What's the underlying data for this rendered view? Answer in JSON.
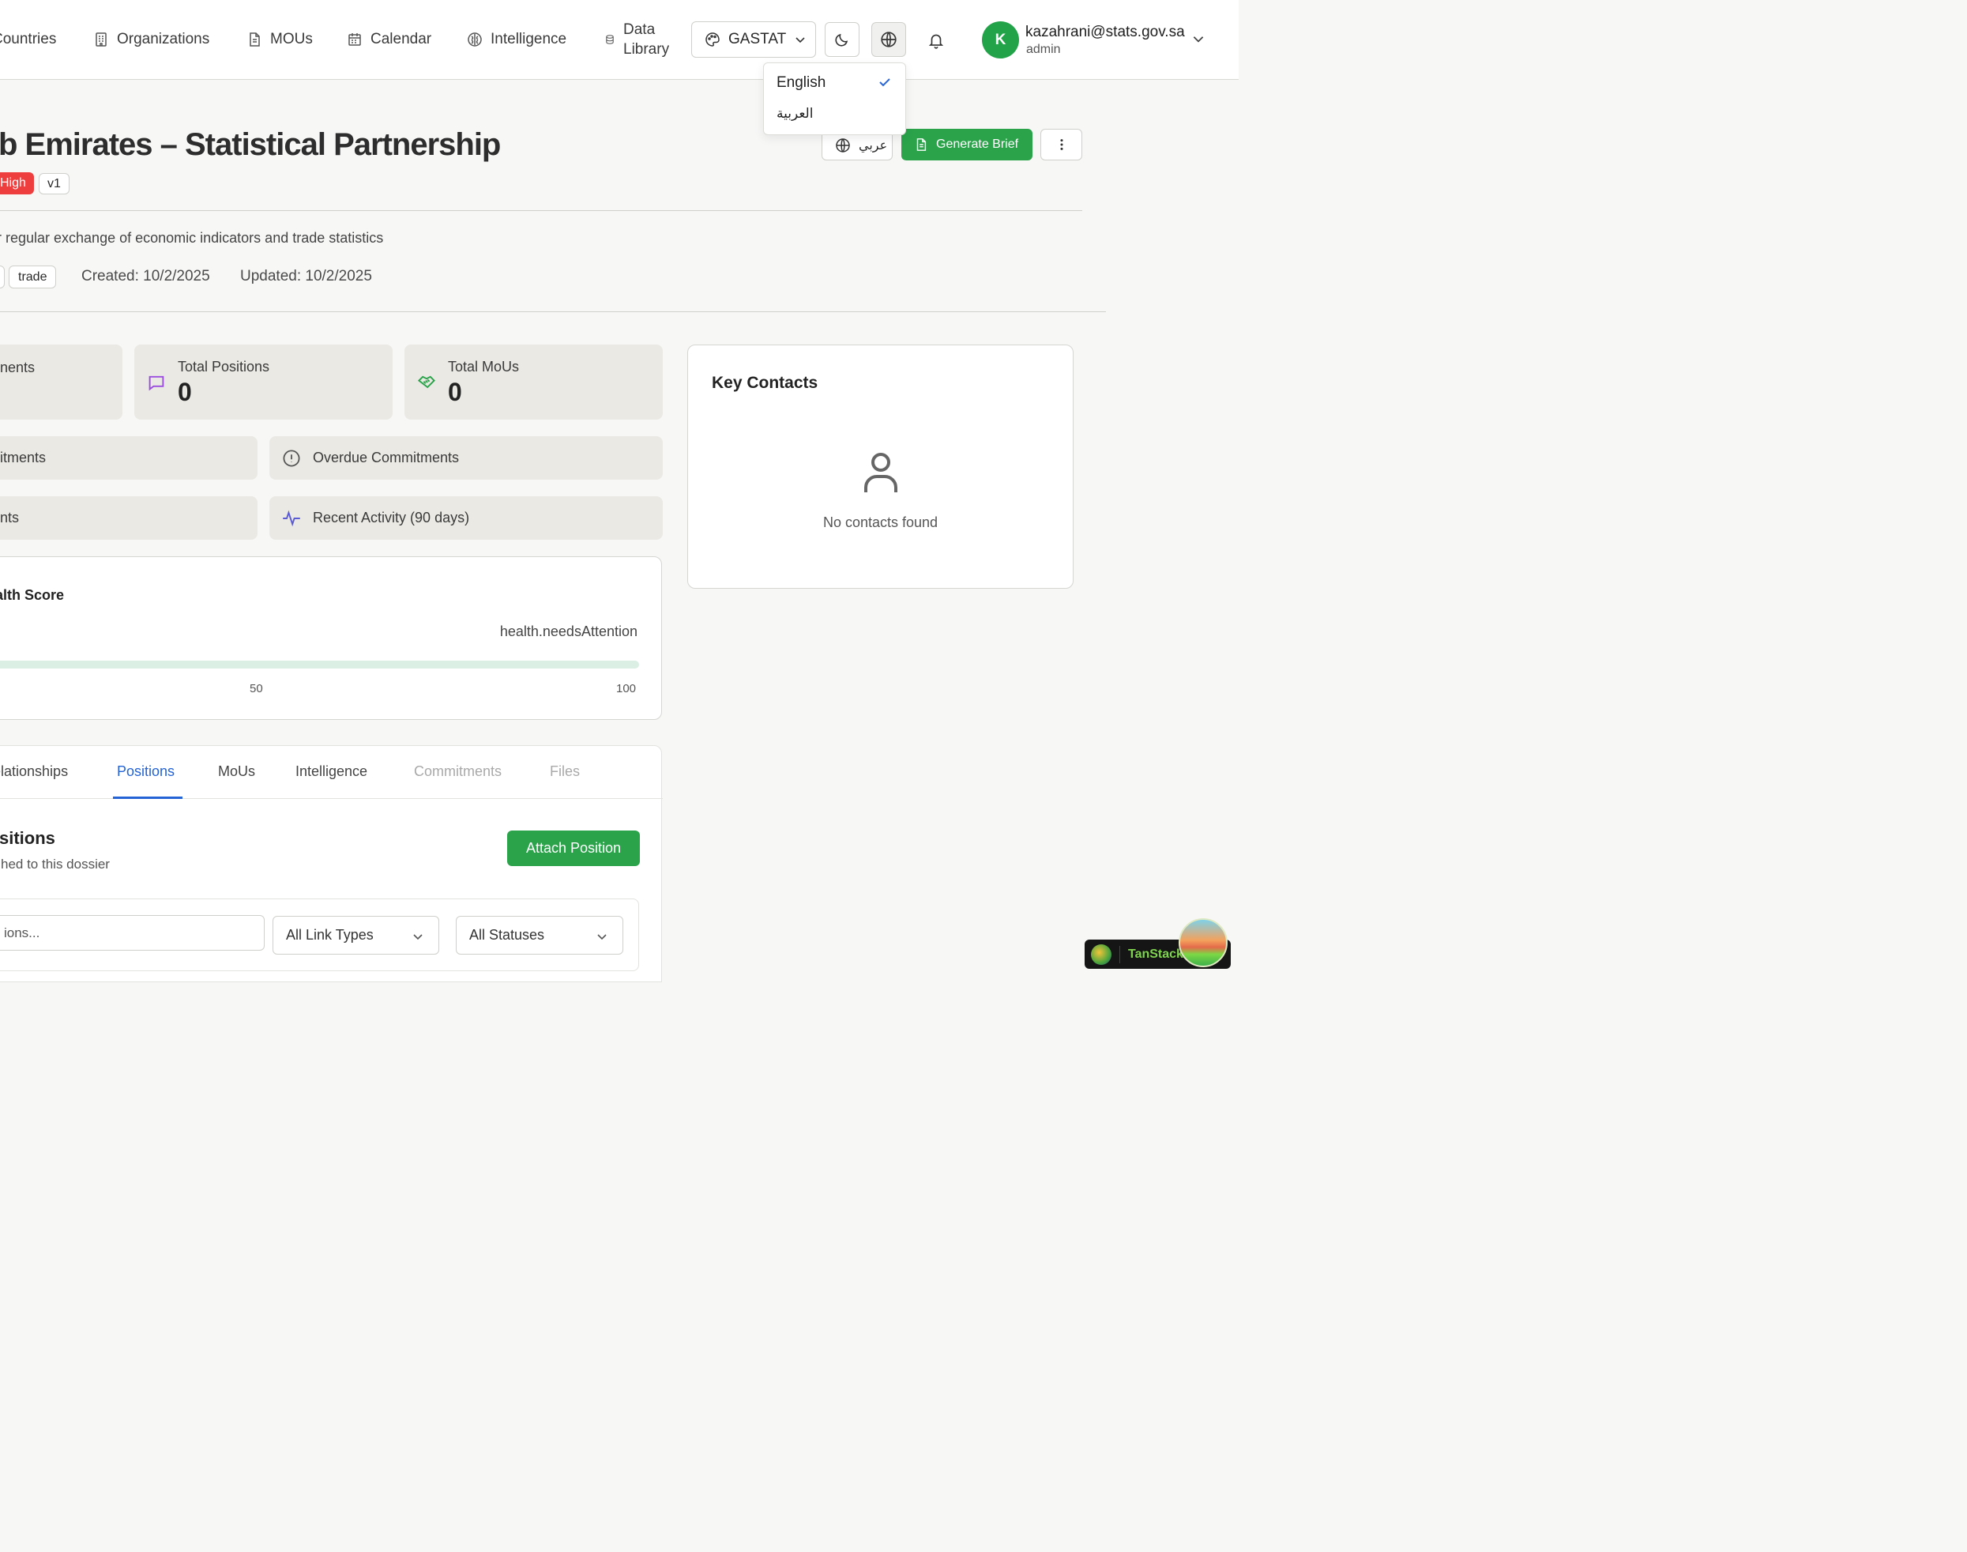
{
  "nav": {
    "items": [
      {
        "label": "Countries",
        "icon": "globe-icon"
      },
      {
        "label": "Organizations",
        "icon": "building-icon"
      },
      {
        "label": "MOUs",
        "icon": "document-icon"
      },
      {
        "label": "Calendar",
        "icon": "calendar-icon"
      },
      {
        "label": "Intelligence",
        "icon": "brain-icon"
      },
      {
        "label_line1": "Data",
        "label_line2": "Library",
        "icon": "database-icon"
      }
    ],
    "theme_label": "GASTAT",
    "user": {
      "initial": "K",
      "email": "kazahrani@stats.gov.sa",
      "role": "admin"
    }
  },
  "language_menu": {
    "options": [
      {
        "label": "English",
        "selected": true
      },
      {
        "label": "العربية",
        "selected": false
      }
    ]
  },
  "dossier": {
    "title": "b Emirates – Statistical Partnership",
    "priority_badge": "High",
    "version_badge": "v1",
    "description": "r regular exchange of economic indicators and trade statistics",
    "tag": "trade",
    "created": "Created: 10/2/2025",
    "updated": "Updated: 10/2/2025",
    "arabic_toggle": "عربي",
    "generate_brief": "Generate Brief"
  },
  "stats": {
    "partial_card_label": "nents",
    "total_positions_label": "Total Positions",
    "total_positions_value": "0",
    "total_mous_label": "Total MoUs",
    "total_mous_value": "0",
    "commitments_partial": "itments",
    "overdue_label": "Overdue Commitments",
    "events_partial": "nts",
    "recent_activity_label": "Recent Activity (90 days)"
  },
  "key_contacts": {
    "title": "Key Contacts",
    "empty": "No contacts found"
  },
  "health": {
    "title": "Health Score",
    "status": "health.needsAttention",
    "tick_mid": "50",
    "tick_max": "100",
    "score_fraction": 0
  },
  "tabs": {
    "items": [
      "elationships",
      "Positions",
      "MoUs",
      "Intelligence",
      "Commitments",
      "Files"
    ]
  },
  "positions": {
    "title": "sitions",
    "subtitle": "hed to this dossier",
    "attach": "Attach Position",
    "search_placeholder": "ions...",
    "link_type": "All Link Types",
    "status": "All Statuses"
  },
  "devtools": {
    "label": "TanStack"
  },
  "colors": {
    "accent_green": "#2aa34b",
    "priority_red": "#ef3e3e",
    "tab_blue": "#2463d6"
  }
}
